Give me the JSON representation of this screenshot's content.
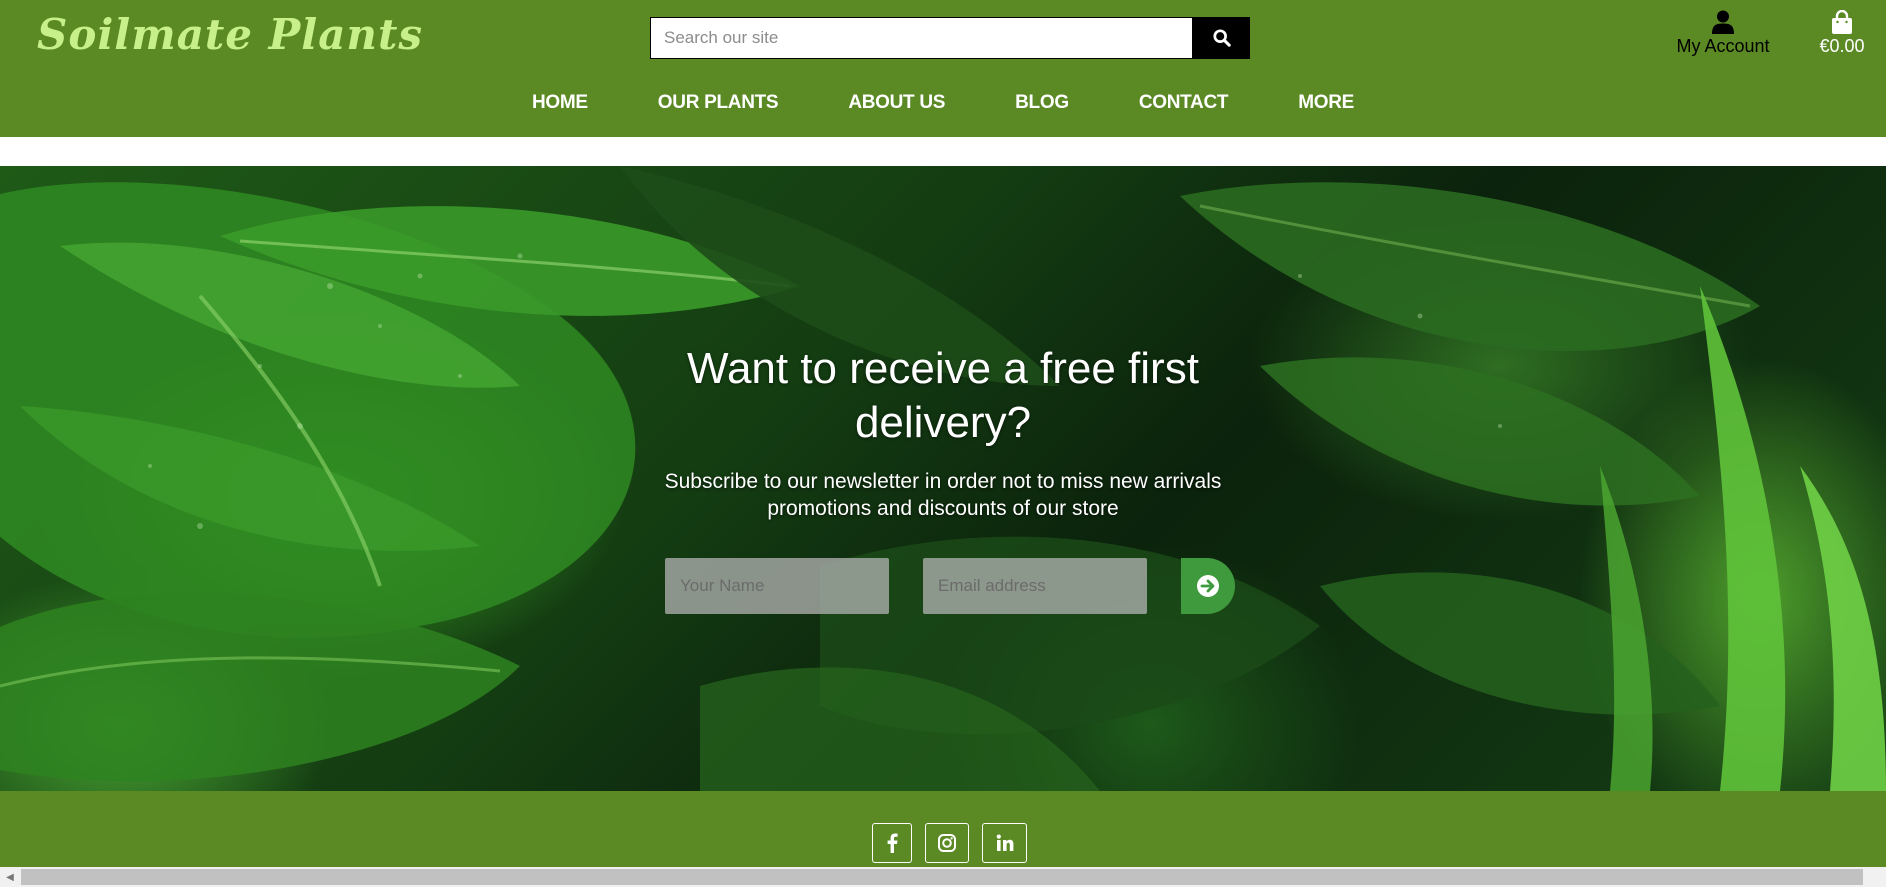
{
  "brand": {
    "logo": "Soilmate Plants"
  },
  "search": {
    "placeholder": "Search our site",
    "value": ""
  },
  "account": {
    "label": "My Account"
  },
  "cart": {
    "total": "€0.00"
  },
  "nav": {
    "items": [
      {
        "label": "HOME"
      },
      {
        "label": "OUR PLANTS"
      },
      {
        "label": "ABOUT US"
      },
      {
        "label": "BLOG"
      },
      {
        "label": "CONTACT"
      },
      {
        "label": "MORE"
      }
    ]
  },
  "hero": {
    "title": "Want to receive a free first delivery?",
    "subtitle": "Subscribe to our newsletter in order not to miss new arrivals promotions and discounts of our store",
    "name_placeholder": "Your Name",
    "email_placeholder": "Email address",
    "submit_icon": "arrow-circle-right-icon"
  },
  "footer": {
    "social": [
      {
        "icon": "facebook-icon"
      },
      {
        "icon": "instagram-icon"
      },
      {
        "icon": "linkedin-icon"
      }
    ]
  },
  "colors": {
    "header_bg": "#5b8a25",
    "logo": "#c7f08a",
    "submit_bg": "#3f9a3e",
    "search_button": "#000000"
  }
}
